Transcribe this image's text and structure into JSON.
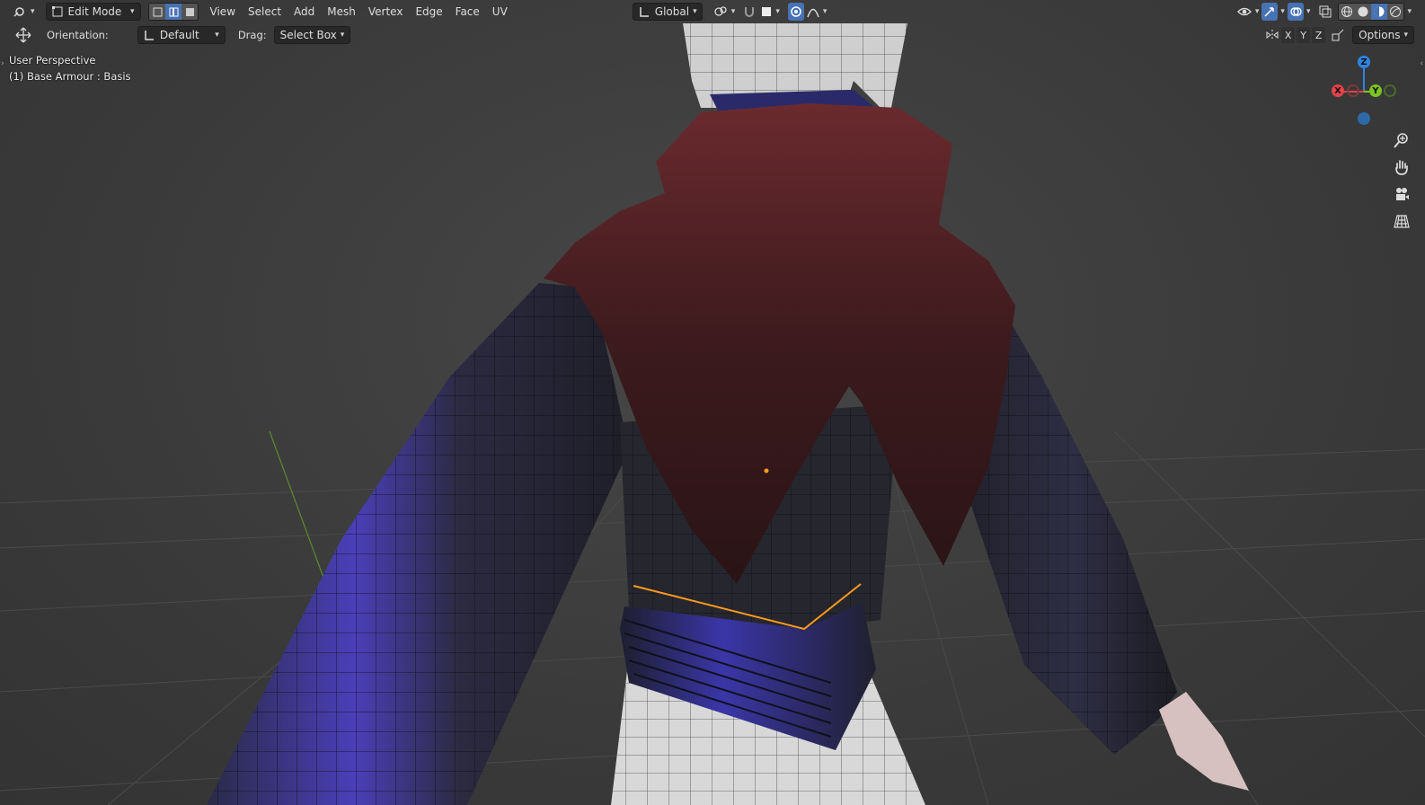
{
  "header": {
    "mode": "Edit Mode",
    "menus": [
      "View",
      "Select",
      "Add",
      "Mesh",
      "Vertex",
      "Edge",
      "Face",
      "UV"
    ],
    "transform_orientation": "Global",
    "select_modes": [
      "vertex",
      "edge",
      "face"
    ],
    "active_select_mode": "edge"
  },
  "tool_settings": {
    "orientation_label": "Orientation:",
    "orientation_value": "Default",
    "drag_label": "Drag:",
    "drag_value": "Select Box",
    "axes": [
      "X",
      "Y",
      "Z"
    ],
    "options_label": "Options"
  },
  "viewport": {
    "perspective": "User Perspective",
    "object_info": "(1) Base Armour : Basis"
  },
  "gizmo": {
    "axes": [
      "X",
      "Y",
      "Z"
    ],
    "colors": {
      "x": "#e5424b",
      "y": "#7cc223",
      "z": "#2f84e0"
    }
  },
  "nav_icons": [
    "zoom-icon",
    "hand-pan-icon",
    "camera-icon",
    "grid-ortho-icon"
  ],
  "colors": {
    "accent": "#4772b3",
    "selected_edge": "#ff9a1f",
    "cape": "#5a1e22",
    "armour": "#2a2a3a"
  }
}
